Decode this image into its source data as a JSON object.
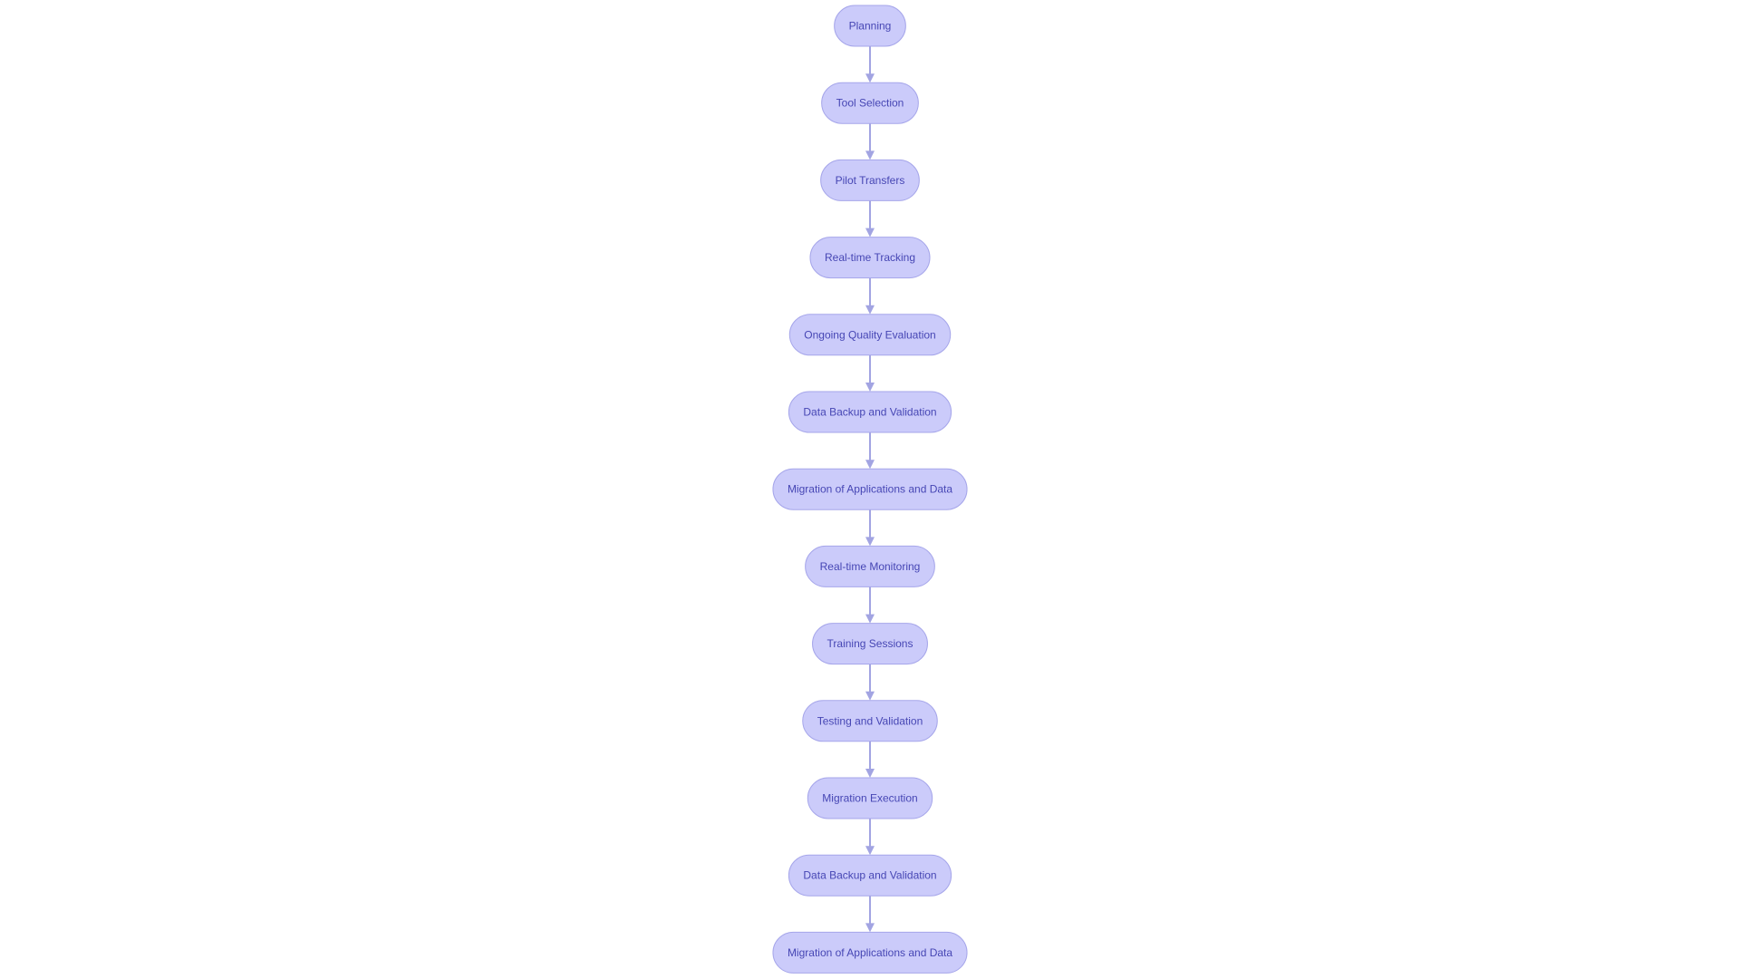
{
  "diagram": {
    "type": "flowchart",
    "direction": "top-to-bottom",
    "colors": {
      "node_fill": "#cbcbfa",
      "node_stroke": "#a6a6ea",
      "node_text": "#4646b4",
      "edge": "#a2a4e2"
    },
    "nodes": [
      {
        "id": "n1",
        "label": "Planning"
      },
      {
        "id": "n2",
        "label": "Tool Selection"
      },
      {
        "id": "n3",
        "label": "Pilot Transfers"
      },
      {
        "id": "n4",
        "label": "Real-time Tracking"
      },
      {
        "id": "n5",
        "label": "Ongoing Quality Evaluation"
      },
      {
        "id": "n6",
        "label": "Data Backup and Validation"
      },
      {
        "id": "n7",
        "label": "Migration of Applications and Data"
      },
      {
        "id": "n8",
        "label": "Real-time Monitoring"
      },
      {
        "id": "n9",
        "label": "Training Sessions"
      },
      {
        "id": "n10",
        "label": "Testing and Validation"
      },
      {
        "id": "n11",
        "label": "Migration Execution"
      },
      {
        "id": "n12",
        "label": "Data Backup and Validation"
      },
      {
        "id": "n13",
        "label": "Migration of Applications and Data"
      }
    ],
    "edges": [
      {
        "from": "n1",
        "to": "n2"
      },
      {
        "from": "n2",
        "to": "n3"
      },
      {
        "from": "n3",
        "to": "n4"
      },
      {
        "from": "n4",
        "to": "n5"
      },
      {
        "from": "n5",
        "to": "n6"
      },
      {
        "from": "n6",
        "to": "n7"
      },
      {
        "from": "n7",
        "to": "n8"
      },
      {
        "from": "n8",
        "to": "n9"
      },
      {
        "from": "n9",
        "to": "n10"
      },
      {
        "from": "n10",
        "to": "n11"
      },
      {
        "from": "n11",
        "to": "n12"
      },
      {
        "from": "n12",
        "to": "n13"
      }
    ]
  }
}
